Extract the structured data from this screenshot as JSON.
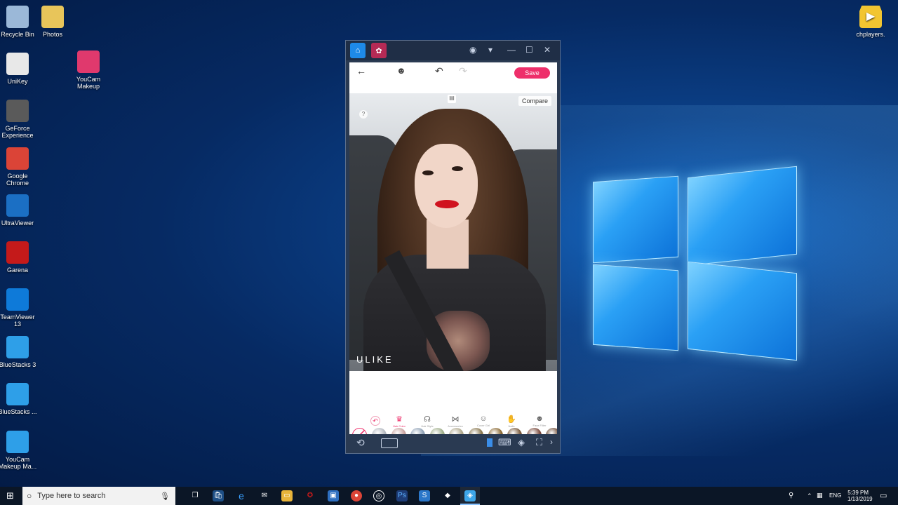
{
  "desktop": {
    "icons_left": [
      {
        "label": "Recycle Bin",
        "icon": "recycle-bin-icon",
        "color": "#9bb8d8"
      },
      {
        "label": "UniKey",
        "icon": "unikey-icon",
        "color": "#e8e8e8"
      },
      {
        "label": "GeForce Experience",
        "icon": "geforce-icon",
        "color": "#5a5a5a"
      },
      {
        "label": "Google Chrome",
        "icon": "chrome-icon",
        "color": "#db4437"
      },
      {
        "label": "UltraViewer",
        "icon": "ultraviewer-icon",
        "color": "#1b6fc4"
      },
      {
        "label": "Garena",
        "icon": "garena-icon",
        "color": "#c41a1a"
      },
      {
        "label": "TeamViewer 13",
        "icon": "teamviewer-icon",
        "color": "#0e7ad9"
      },
      {
        "label": "BlueStacks 3",
        "icon": "bluestacks-icon",
        "color": "#2e9fe8"
      },
      {
        "label": "BlueStacks ...",
        "icon": "bluestacks-icon",
        "color": "#2e9fe8"
      },
      {
        "label": "YouCam Makeup Ma...",
        "icon": "bluestacks-icon",
        "color": "#2e9fe8"
      }
    ],
    "icons_col2": [
      {
        "label": "Photos",
        "icon": "photos-folder-icon",
        "color": "#e8c55a"
      },
      {
        "label": "YouCam Makeup",
        "icon": "youcam-icon",
        "color": "#e0396d"
      }
    ],
    "icon_right": {
      "label": "chplayers.",
      "icon": "chplay-icon",
      "color": "#f2c531"
    }
  },
  "app": {
    "save_label": "Save",
    "compare_label": "Compare",
    "watermark": "ULIKE",
    "accent": "#ee2f6a",
    "hair_colors": [
      "#b5b9c1",
      "#c9a4a1",
      "#8fa1b6",
      "#9fae8a",
      "#b0a88c",
      "#8a7850",
      "#8c6b36",
      "#7a5a3c",
      "#7b4b3e",
      "#6d4a33"
    ],
    "tools": [
      {
        "icon": "hair-color-icon",
        "label": "Hair Color",
        "active": true
      },
      {
        "icon": "hair-style-icon",
        "label": "Hair Style"
      },
      {
        "icon": "accessories-icon",
        "label": "Accessories"
      },
      {
        "icon": "cover-girl-icon",
        "label": "Cover Girl"
      },
      {
        "icon": "nails-icon",
        "label": "Nails"
      },
      {
        "icon": "face-filter-icon",
        "label": "Face Filter"
      }
    ]
  },
  "taskbar": {
    "search_placeholder": "Type here to search",
    "language": "ENG",
    "time": "5:39 PM",
    "date": "1/13/2019"
  }
}
